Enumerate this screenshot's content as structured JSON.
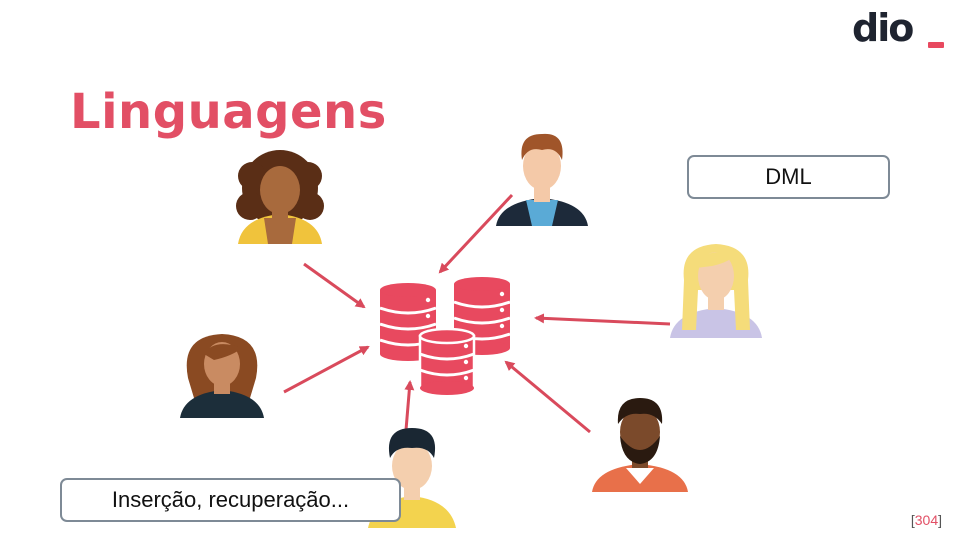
{
  "slide": {
    "title": "Linguagens",
    "dml_label": "DML",
    "operations_label": "Inserção, recuperação...",
    "page_open": "[",
    "page_number": "304",
    "page_close": "]"
  },
  "logo": {
    "text": "dio"
  },
  "icons": {
    "database": "database-stack-icon",
    "people": [
      "person-curly-hair-icon",
      "person-brown-hair-icon",
      "person-blonde-icon",
      "person-wavy-hair-icon",
      "person-black-hair-icon",
      "person-beard-icon"
    ]
  },
  "colors": {
    "accent": "#e24f65",
    "database": "#e8495f",
    "arrow": "#d94a5c",
    "box_border": "#7e8a96"
  }
}
